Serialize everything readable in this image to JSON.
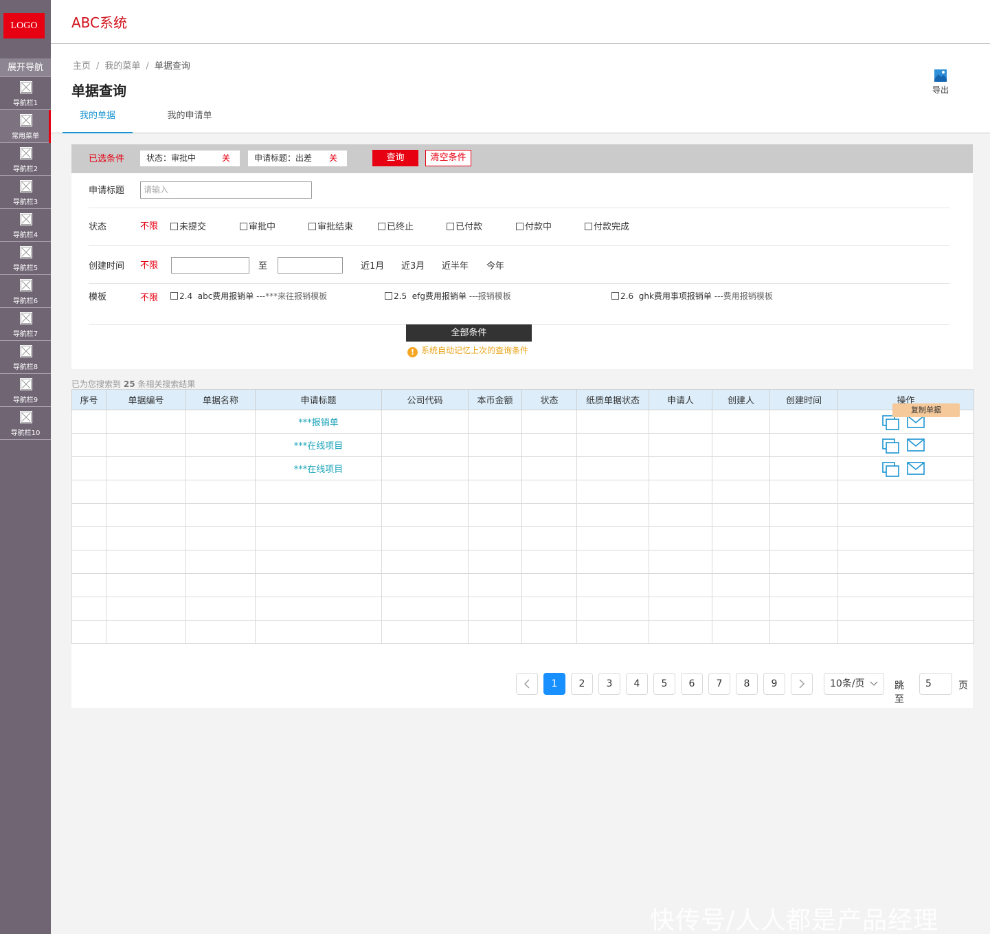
{
  "logo": "LOGO",
  "app_title": "ABC系统",
  "sidebar": {
    "expand": "展开导航",
    "items": [
      "导航栏1",
      "常用菜单",
      "导航栏2",
      "导航栏3",
      "导航栏4",
      "导航栏5",
      "导航栏6",
      "导航栏7",
      "导航栏8",
      "导航栏9",
      "导航栏10"
    ],
    "active_index": 1,
    "accent": "#e60012"
  },
  "breadcrumb": [
    "主页",
    "我的菜单",
    "单据查询"
  ],
  "breadcrumb_sep": "/",
  "page_title": "单据查询",
  "export_label": "导出",
  "tabs": [
    "我的单据",
    "我的申请单"
  ],
  "filters": {
    "chosen_label": "已选条件",
    "chips": [
      {
        "text": "状态：审批中",
        "close": "关"
      },
      {
        "text": "申请标题：出差",
        "close": "关"
      }
    ],
    "query_btn": "查询",
    "clear_btn": "清空条件",
    "title_label": "申请标题",
    "title_placeholder": "请输入",
    "status_label": "状态",
    "unlimited": "不限",
    "status_options": [
      "未提交",
      "审批中",
      "审批结束",
      "已终止",
      "已付款",
      "付款中",
      "付款完成"
    ],
    "created_label": "创建时间",
    "to": "至",
    "quick_ranges": [
      "近1月",
      "近3月",
      "近半年",
      "今年"
    ],
    "template_label": "模板",
    "templates": [
      {
        "code": "2.4",
        "name": "abc费用报销单",
        "desc": "---***来往报销模板"
      },
      {
        "code": "2.5",
        "name": "efg费用报销单",
        "desc": "---报销模板"
      },
      {
        "code": "2.6",
        "name": "ghk费用事项报销单",
        "desc": "---费用报销模板"
      }
    ],
    "all_btn": "全部条件",
    "memory_tip": "系统自动记忆上次的查询条件",
    "warn": "!"
  },
  "results": {
    "prefix": "已为您搜索到",
    "count": "25",
    "suffix": "条相关搜索结果"
  },
  "table": {
    "headers": [
      "序号",
      "单据编号",
      "单据名称",
      "申请标题",
      "公司代码",
      "本币金额",
      "状态",
      "纸质单据状态",
      "申请人",
      "创建人",
      "创建时间",
      "操作"
    ],
    "rows": [
      {
        "title": "***报销单",
        "has_ops": true
      },
      {
        "title": "***在线项目",
        "has_ops": true
      },
      {
        "title": "***在线项目",
        "has_ops": true
      },
      {
        "title": "",
        "has_ops": false
      },
      {
        "title": "",
        "has_ops": false
      },
      {
        "title": "",
        "has_ops": false
      },
      {
        "title": "",
        "has_ops": false
      },
      {
        "title": "",
        "has_ops": false
      },
      {
        "title": "",
        "has_ops": false
      },
      {
        "title": "",
        "has_ops": false
      }
    ],
    "tooltip": "复制单据",
    "link_color": "#1aa3b8",
    "header_bg": "#ddeefa"
  },
  "pagination": {
    "pages": [
      "1",
      "2",
      "3",
      "4",
      "5",
      "6",
      "7",
      "8",
      "9"
    ],
    "current": "1",
    "page_size": "10条/页",
    "jump_label": "跳至",
    "jump_value": "5",
    "page_unit": "页",
    "accent": "#1890ff"
  },
  "watermark": "快传号/人人都是产品经理"
}
